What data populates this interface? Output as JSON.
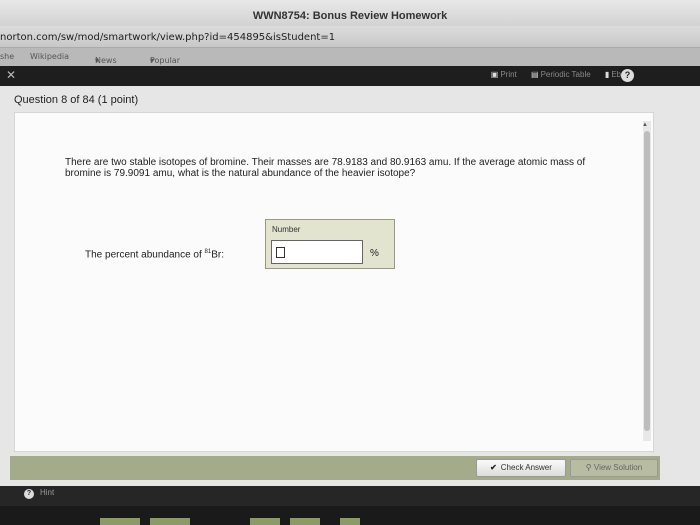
{
  "window": {
    "title": "WWN8754: Bonus Review Homework"
  },
  "browser": {
    "url": "norton.com/sw/mod/smartwork/view.php?id=454895&isStudent=1",
    "bookmarks": [
      "she",
      "Wikipedia",
      "News",
      "Popular"
    ]
  },
  "toolbar": {
    "print_label": "Print",
    "periodic_table_label": "Periodic Table",
    "ebook_label": "Ebook",
    "help_symbol": "?"
  },
  "question": {
    "header": "Question 8 of 84 (1 point)",
    "text": "There are two stable isotopes of bromine. Their masses are 78.9183 and 80.9163 amu. If the average atomic mass of bromine is 79.9091 amu, what is the natural abundance of the heavier isotope?",
    "answer_label_prefix": "The percent abundance of ",
    "answer_label_isotope_mass": "81",
    "answer_label_suffix": "Br:",
    "input_box_label": "Number",
    "input_value": "",
    "unit": "%"
  },
  "actions": {
    "check_answer_label": "Check Answer",
    "view_solution_label": "View Solution",
    "hint_label": "Hint",
    "hint_symbol": "?"
  }
}
